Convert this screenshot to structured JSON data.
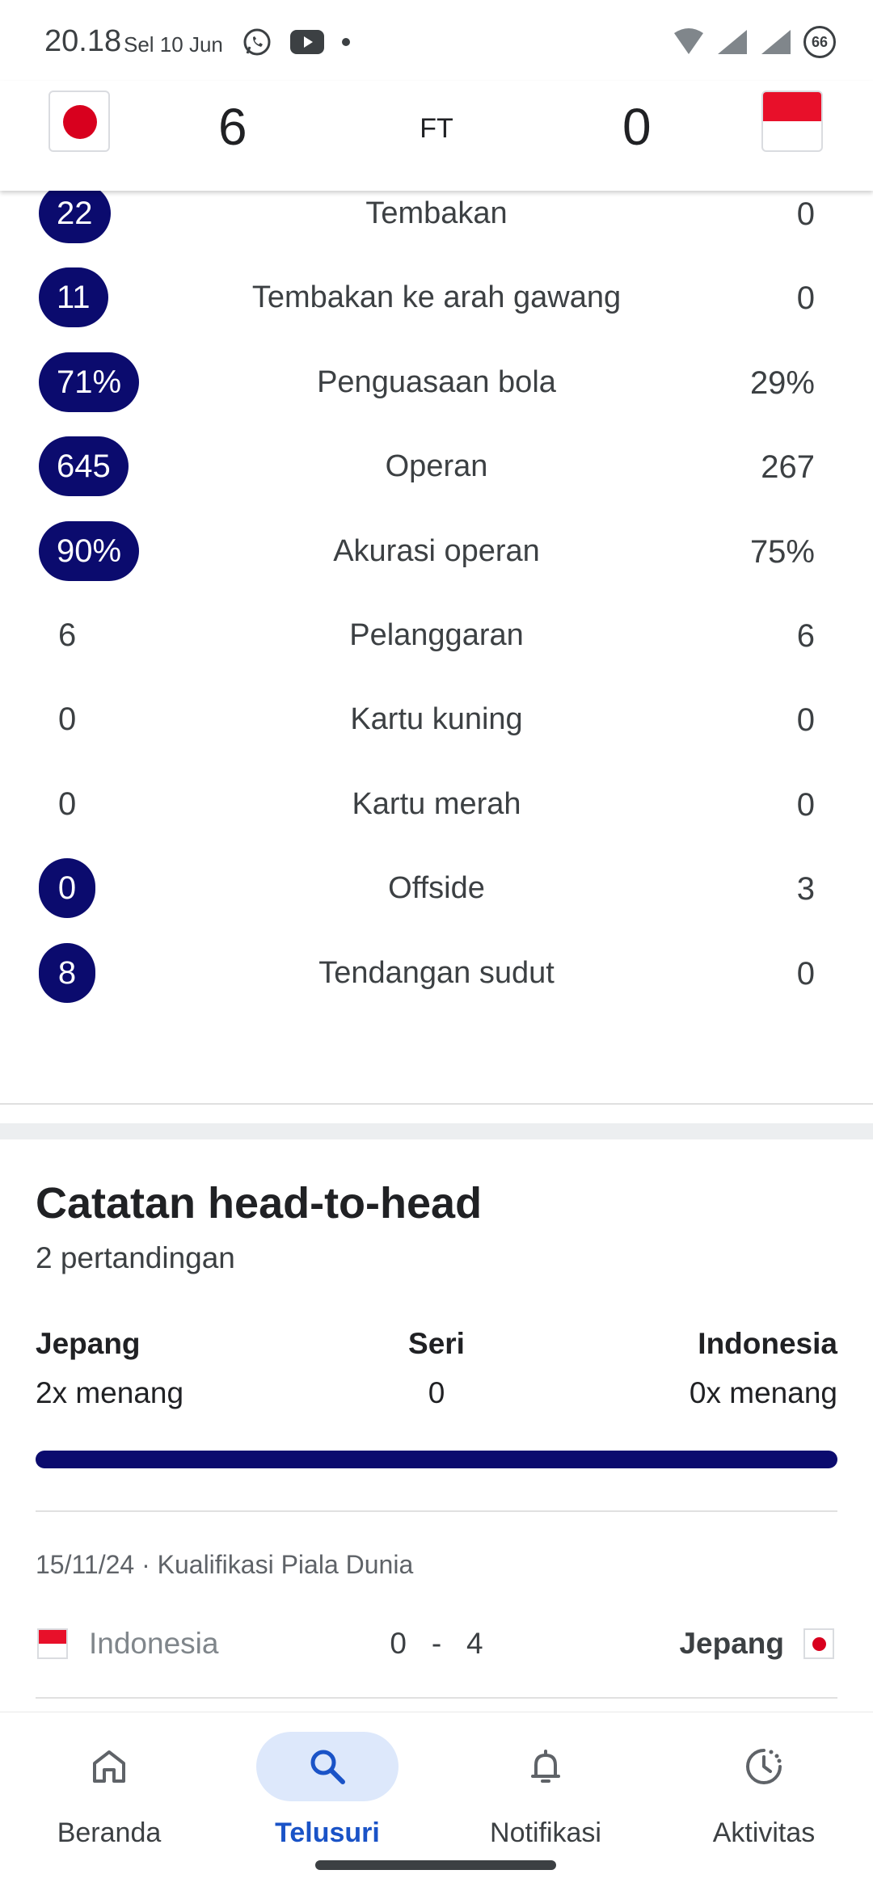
{
  "status_bar": {
    "time": "20.18",
    "date": "Sel 10 Jun",
    "battery": "66",
    "icons_left": [
      "whatsapp-icon",
      "youtube-icon",
      "dot-icon"
    ],
    "icons_right": [
      "wifi-icon",
      "signal-icon",
      "signal-icon",
      "battery-icon"
    ]
  },
  "match": {
    "home_score": "6",
    "status": "FT",
    "away_score": "0",
    "home_flag": "japan-flag",
    "away_flag": "indonesia-flag"
  },
  "stats": [
    {
      "left": "22",
      "label": "Tembakan",
      "right": "0",
      "highlight": true
    },
    {
      "left": "11",
      "label": "Tembakan ke arah gawang",
      "right": "0",
      "highlight": true
    },
    {
      "left": "71%",
      "label": "Penguasaan bola",
      "right": "29%",
      "highlight": true
    },
    {
      "left": "645",
      "label": "Operan",
      "right": "267",
      "highlight": true
    },
    {
      "left": "90%",
      "label": "Akurasi operan",
      "right": "75%",
      "highlight": true
    },
    {
      "left": "6",
      "label": "Pelanggaran",
      "right": "6",
      "highlight": false
    },
    {
      "left": "0",
      "label": "Kartu kuning",
      "right": "0",
      "highlight": false
    },
    {
      "left": "0",
      "label": "Kartu merah",
      "right": "0",
      "highlight": false
    },
    {
      "left": "0",
      "label": "Offside",
      "right": "3",
      "highlight": true
    },
    {
      "left": "8",
      "label": "Tendangan sudut",
      "right": "0",
      "highlight": true
    }
  ],
  "h2h": {
    "title": "Catatan head-to-head",
    "subtitle": "2 pertandingan",
    "left_team": "Jepang",
    "left_value": "2x menang",
    "draw_label": "Seri",
    "draw_value": "0",
    "right_team": "Indonesia",
    "right_value": "0x menang",
    "bar_color": "#0b0b6e"
  },
  "recent_match": {
    "meta": "15/11/24 · Kualifikasi Piala Dunia",
    "home_team": "Indonesia",
    "home_score": "0",
    "separator": "-",
    "away_score": "4",
    "away_team": "Jepang"
  },
  "nav": {
    "items": [
      {
        "label": "Beranda",
        "icon": "home-icon",
        "active": false
      },
      {
        "label": "Telusuri",
        "icon": "search-icon",
        "active": true
      },
      {
        "label": "Notifikasi",
        "icon": "bell-icon",
        "active": false
      },
      {
        "label": "Aktivitas",
        "icon": "activity-icon",
        "active": false
      }
    ]
  },
  "colors": {
    "accent_navy": "#0b0b6e",
    "active_blue": "#1a53c7",
    "active_pill": "#dde8fb"
  }
}
